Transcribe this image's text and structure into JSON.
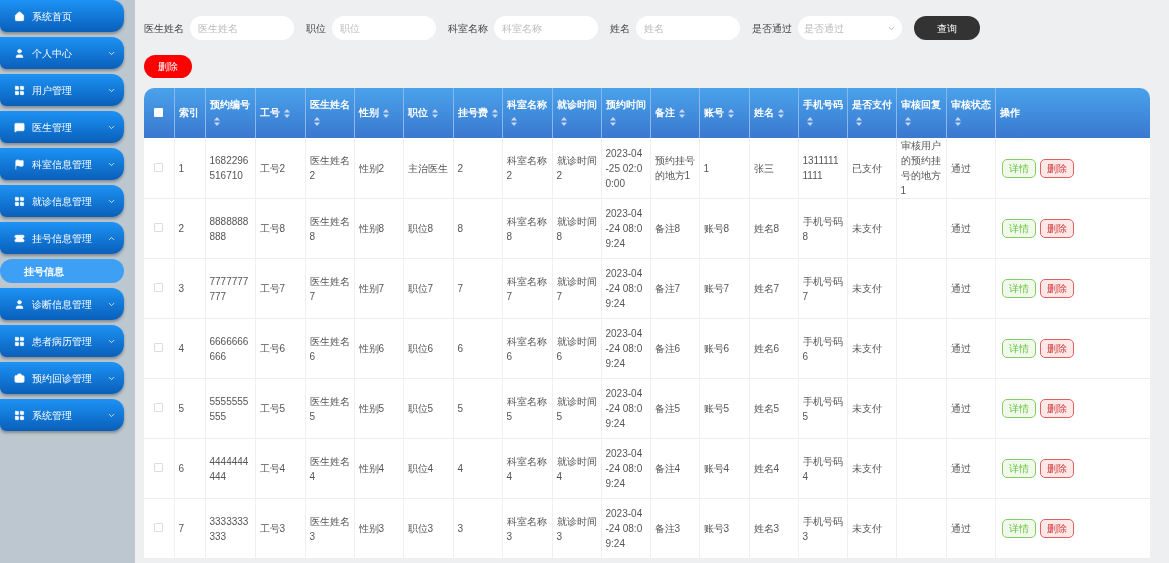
{
  "sidebar": {
    "items": [
      {
        "label": "系统首页"
      },
      {
        "label": "个人中心",
        "expanded": false
      },
      {
        "label": "用户管理",
        "expanded": false
      },
      {
        "label": "医生管理",
        "expanded": false
      },
      {
        "label": "科室信息管理",
        "expanded": false
      },
      {
        "label": "就诊信息管理",
        "expanded": false
      },
      {
        "label": "挂号信息管理",
        "expanded": true,
        "children": [
          {
            "label": "挂号信息",
            "selected": true
          }
        ]
      },
      {
        "label": "诊断信息管理",
        "expanded": false
      },
      {
        "label": "患者病历管理",
        "expanded": false
      },
      {
        "label": "预约回诊管理",
        "expanded": false
      },
      {
        "label": "系统管理",
        "expanded": false
      }
    ]
  },
  "filters": [
    {
      "kind": "input",
      "label": "医生姓名",
      "placeholder": "医生姓名"
    },
    {
      "kind": "input",
      "label": "职位",
      "placeholder": "职位"
    },
    {
      "kind": "input",
      "label": "科室名称",
      "placeholder": "科室名称"
    },
    {
      "kind": "input",
      "label": "姓名",
      "placeholder": "姓名"
    },
    {
      "kind": "select",
      "label": "是否通过",
      "placeholder": "是否通过"
    }
  ],
  "search_button": "查询",
  "delete_button": "删除",
  "table": {
    "select_all_checked": false,
    "columns": [
      {
        "label": "索引",
        "sortable": false
      },
      {
        "label": "预约编号",
        "sortable": true
      },
      {
        "label": "工号",
        "sortable": true
      },
      {
        "label": "医生姓名",
        "sortable": true
      },
      {
        "label": "性别",
        "sortable": true
      },
      {
        "label": "职位",
        "sortable": true
      },
      {
        "label": "挂号费",
        "sortable": true
      },
      {
        "label": "科室名称",
        "sortable": true
      },
      {
        "label": "就诊时间",
        "sortable": true
      },
      {
        "label": "预约时间",
        "sortable": true
      },
      {
        "label": "备注",
        "sortable": true
      },
      {
        "label": "账号",
        "sortable": true
      },
      {
        "label": "姓名",
        "sortable": true
      },
      {
        "label": "手机号码",
        "sortable": true
      },
      {
        "label": "是否支付",
        "sortable": true
      },
      {
        "label": "审核回复",
        "sortable": true
      },
      {
        "label": "审核状态",
        "sortable": true
      },
      {
        "label": "操作",
        "sortable": false
      }
    ],
    "rows": [
      {
        "checked": false,
        "cells": [
          "1",
          "1682296516710",
          "工号2",
          "医生姓名2",
          "性别2",
          "主治医生",
          "2",
          "科室名称2",
          "就诊时间2",
          "2023-04-25 02:00:00",
          "预约挂号的地方1",
          "1",
          "张三",
          "13111111111",
          "已支付",
          "审核用户的预约挂号的地方1",
          "通过"
        ],
        "actions": [
          "详情",
          "删除"
        ]
      },
      {
        "checked": false,
        "cells": [
          "2",
          "8888888888",
          "工号8",
          "医生姓名8",
          "性别8",
          "职位8",
          "8",
          "科室名称8",
          "就诊时间8",
          "2023-04-24 08:09:24",
          "备注8",
          "账号8",
          "姓名8",
          "手机号码8",
          "未支付",
          "",
          "通过"
        ],
        "actions": [
          "详情",
          "删除"
        ]
      },
      {
        "checked": false,
        "cells": [
          "3",
          "7777777777",
          "工号7",
          "医生姓名7",
          "性别7",
          "职位7",
          "7",
          "科室名称7",
          "就诊时间7",
          "2023-04-24 08:09:24",
          "备注7",
          "账号7",
          "姓名7",
          "手机号码7",
          "未支付",
          "",
          "通过"
        ],
        "actions": [
          "详情",
          "删除"
        ]
      },
      {
        "checked": false,
        "cells": [
          "4",
          "6666666666",
          "工号6",
          "医生姓名6",
          "性别6",
          "职位6",
          "6",
          "科室名称6",
          "就诊时间6",
          "2023-04-24 08:09:24",
          "备注6",
          "账号6",
          "姓名6",
          "手机号码6",
          "未支付",
          "",
          "通过"
        ],
        "actions": [
          "详情",
          "删除"
        ]
      },
      {
        "checked": false,
        "cells": [
          "5",
          "5555555555",
          "工号5",
          "医生姓名5",
          "性别5",
          "职位5",
          "5",
          "科室名称5",
          "就诊时间5",
          "2023-04-24 08:09:24",
          "备注5",
          "账号5",
          "姓名5",
          "手机号码5",
          "未支付",
          "",
          "通过"
        ],
        "actions": [
          "详情",
          "删除"
        ]
      },
      {
        "checked": false,
        "cells": [
          "6",
          "4444444444",
          "工号4",
          "医生姓名4",
          "性别4",
          "职位4",
          "4",
          "科室名称4",
          "就诊时间4",
          "2023-04-24 08:09:24",
          "备注4",
          "账号4",
          "姓名4",
          "手机号码4",
          "未支付",
          "",
          "通过"
        ],
        "actions": [
          "详情",
          "删除"
        ]
      },
      {
        "checked": false,
        "cells": [
          "7",
          "3333333333",
          "工号3",
          "医生姓名3",
          "性别3",
          "职位3",
          "3",
          "科室名称3",
          "就诊时间3",
          "2023-04-24 08:09:24",
          "备注3",
          "账号3",
          "姓名3",
          "手机号码3",
          "未支付",
          "",
          "通过"
        ],
        "actions": [
          "详情",
          "删除"
        ]
      }
    ]
  }
}
